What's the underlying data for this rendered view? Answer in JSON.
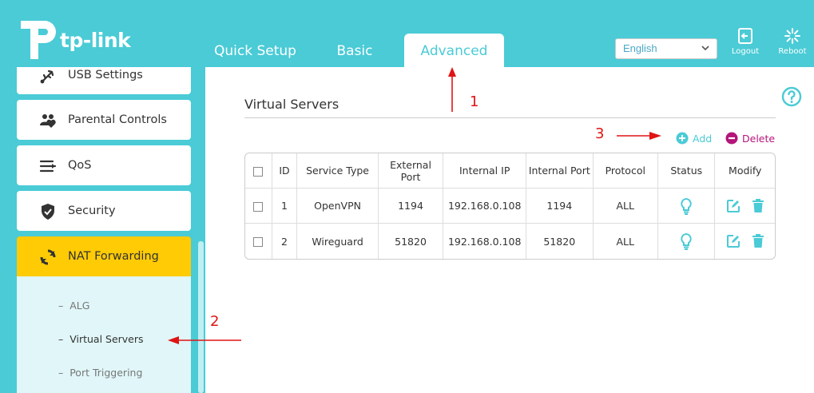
{
  "brand": {
    "logo_text": "tp-link"
  },
  "nav": {
    "tabs": [
      {
        "label": "Quick Setup"
      },
      {
        "label": "Basic"
      },
      {
        "label": "Advanced",
        "active": true
      }
    ]
  },
  "header": {
    "language": "English",
    "logout_label": "Logout",
    "reboot_label": "Reboot"
  },
  "sidebar": {
    "items": [
      {
        "label": "USB Settings",
        "icon": "usb-icon"
      },
      {
        "label": "Parental Controls",
        "icon": "parental-controls-icon"
      },
      {
        "label": "QoS",
        "icon": "qos-icon"
      },
      {
        "label": "Security",
        "icon": "shield-icon"
      },
      {
        "label": "NAT Forwarding",
        "icon": "nat-forwarding-icon",
        "active": true
      }
    ],
    "submenu": [
      {
        "label": "ALG"
      },
      {
        "label": "Virtual Servers",
        "active": true
      },
      {
        "label": "Port Triggering"
      }
    ]
  },
  "main": {
    "title": "Virtual Servers",
    "add_label": "Add",
    "delete_label": "Delete",
    "table": {
      "headers": [
        "ID",
        "Service Type",
        "External Port",
        "Internal IP",
        "Internal Port",
        "Protocol",
        "Status",
        "Modify"
      ],
      "rows": [
        {
          "id": "1",
          "service": "OpenVPN",
          "ext_port": "1194",
          "int_ip": "192.168.0.108",
          "int_port": "1194",
          "protocol": "ALL"
        },
        {
          "id": "2",
          "service": "Wireguard",
          "ext_port": "51820",
          "int_ip": "192.168.0.108",
          "int_port": "51820",
          "protocol": "ALL"
        }
      ]
    }
  },
  "annotations": {
    "step1": "1",
    "step2": "2",
    "step3": "3"
  },
  "colors": {
    "header_bg": "#4acbd6",
    "accent": "#4acbd6",
    "active_item": "#ffcb05",
    "delete": "#b4157a",
    "annotation": "#e01414"
  }
}
